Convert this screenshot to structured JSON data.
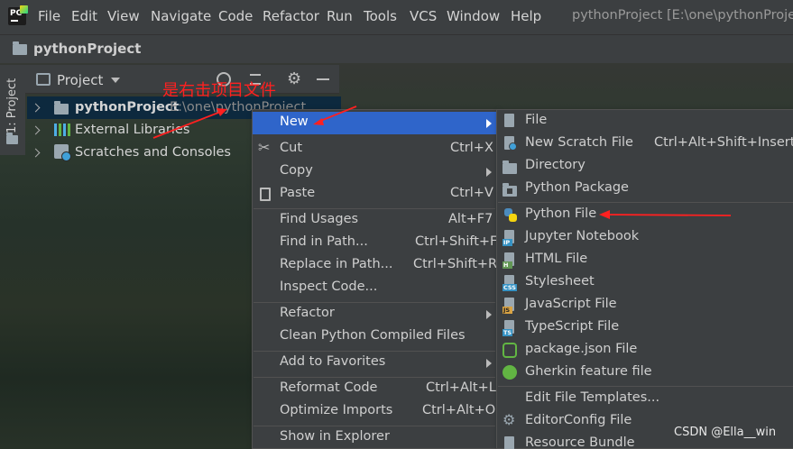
{
  "menubar": {
    "items": [
      "File",
      "Edit",
      "View",
      "Navigate",
      "Code",
      "Refactor",
      "Run",
      "Tools",
      "VCS",
      "Window",
      "Help"
    ],
    "window_title": "pythonProject [E:\\one\\pythonProjec"
  },
  "navbar": {
    "project_name": "pythonProject"
  },
  "side_tab": {
    "label": "1: Project"
  },
  "project_panel": {
    "title": "Project",
    "tree": [
      {
        "name": "pythonProject",
        "path": "E:\\one\\pythonProject"
      },
      {
        "name": "External Libraries"
      },
      {
        "name": "Scratches and Consoles"
      }
    ]
  },
  "annotation": {
    "text": "是右击项目文件"
  },
  "context_menu": {
    "items": [
      {
        "label": "New",
        "shortcut": ""
      },
      {
        "label": "Cut",
        "shortcut": "Ctrl+X"
      },
      {
        "label": "Copy",
        "shortcut": ""
      },
      {
        "label": "Paste",
        "shortcut": "Ctrl+V"
      },
      {
        "label": "Find Usages",
        "shortcut": "Alt+F7"
      },
      {
        "label": "Find in Path...",
        "shortcut": "Ctrl+Shift+F"
      },
      {
        "label": "Replace in Path...",
        "shortcut": "Ctrl+Shift+R"
      },
      {
        "label": "Inspect Code...",
        "shortcut": ""
      },
      {
        "label": "Refactor",
        "shortcut": ""
      },
      {
        "label": "Clean Python Compiled Files",
        "shortcut": ""
      },
      {
        "label": "Add to Favorites",
        "shortcut": ""
      },
      {
        "label": "Reformat Code",
        "shortcut": "Ctrl+Alt+L"
      },
      {
        "label": "Optimize Imports",
        "shortcut": "Ctrl+Alt+O"
      },
      {
        "label": "Show in Explorer",
        "shortcut": ""
      }
    ]
  },
  "new_submenu": {
    "items": [
      {
        "label": "File",
        "shortcut": ""
      },
      {
        "label": "New Scratch File",
        "shortcut": "Ctrl+Alt+Shift+Insert"
      },
      {
        "label": "Directory",
        "shortcut": ""
      },
      {
        "label": "Python Package",
        "shortcut": ""
      },
      {
        "label": "Python File",
        "shortcut": ""
      },
      {
        "label": "Jupyter Notebook",
        "shortcut": ""
      },
      {
        "label": "HTML File",
        "shortcut": ""
      },
      {
        "label": "Stylesheet",
        "shortcut": ""
      },
      {
        "label": "JavaScript File",
        "shortcut": ""
      },
      {
        "label": "TypeScript File",
        "shortcut": ""
      },
      {
        "label": "package.json File",
        "shortcut": ""
      },
      {
        "label": "Gherkin feature file",
        "shortcut": ""
      },
      {
        "label": "Edit File Templates...",
        "shortcut": ""
      },
      {
        "label": "EditorConfig File",
        "shortcut": ""
      },
      {
        "label": "Resource Bundle",
        "shortcut": ""
      }
    ],
    "icon_tags": {
      "jupyter": "IP",
      "html": "H",
      "css": "CSS",
      "js": "JS",
      "ts": "TS"
    }
  },
  "watermark": {
    "text": "CSDN @Ella__win"
  },
  "colors": {
    "highlight": "#2f65ca",
    "annotation": "#ff2020",
    "background": "#3c3f41"
  }
}
